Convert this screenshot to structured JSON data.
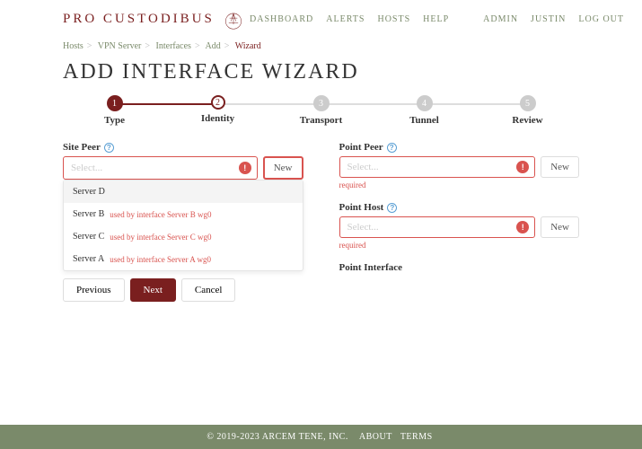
{
  "brand": "PRO CUSTODIBUS",
  "nav": {
    "dashboard": "DASHBOARD",
    "alerts": "ALERTS",
    "hosts": "HOSTS",
    "help": "HELP",
    "admin": "ADMIN",
    "user": "JUSTIN",
    "logout": "LOG OUT"
  },
  "breadcrumb": {
    "b0": "Hosts",
    "b1": "VPN Server",
    "b2": "Interfaces",
    "b3": "Add",
    "b4": "Wizard"
  },
  "title": "ADD INTERFACE WIZARD",
  "steps": {
    "s1": {
      "num": "1",
      "label": "Type"
    },
    "s2": {
      "num": "2",
      "label": "Identity"
    },
    "s3": {
      "num": "3",
      "label": "Transport"
    },
    "s4": {
      "num": "4",
      "label": "Tunnel"
    },
    "s5": {
      "num": "5",
      "label": "Review"
    }
  },
  "fields": {
    "sitePeer": {
      "label": "Site Peer",
      "placeholder": "Select...",
      "newBtn": "New"
    },
    "pointPeer": {
      "label": "Point Peer",
      "placeholder": "Select...",
      "newBtn": "New",
      "required": "required"
    },
    "pointHost": {
      "label": "Point Host",
      "placeholder": "Select...",
      "newBtn": "New",
      "required": "required"
    },
    "pointInterface": {
      "label": "Point Interface"
    }
  },
  "dropdown": {
    "i0": {
      "name": "Server D",
      "used": ""
    },
    "i1": {
      "name": "Server B",
      "used": "used by interface Server B wg0"
    },
    "i2": {
      "name": "Server C",
      "used": "used by interface Server C wg0"
    },
    "i3": {
      "name": "Server A",
      "used": "used by interface Server A wg0"
    }
  },
  "buttons": {
    "prev": "Previous",
    "next": "Next",
    "cancel": "Cancel"
  },
  "footer": {
    "copyright": "© 2019-2023 ARCEM TENE, INC.",
    "about": "ABOUT",
    "terms": "TERMS"
  }
}
